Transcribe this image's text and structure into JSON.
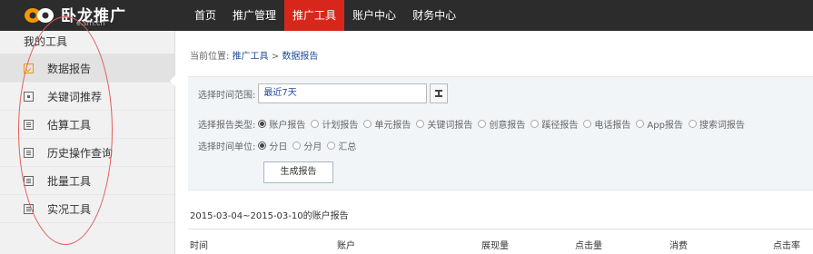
{
  "logo": {
    "text": "卧龙推广",
    "sub": "e.sm.cn"
  },
  "nav": [
    "首页",
    "推广管理",
    "推广工具",
    "账户中心",
    "财务中心"
  ],
  "nav_active_index": 2,
  "sidebar": {
    "title": "我的工具",
    "items": [
      {
        "label": "数据报告",
        "icon": "report-icon"
      },
      {
        "label": "关键词推荐",
        "icon": "target-icon"
      },
      {
        "label": "估算工具",
        "icon": "calculator-icon"
      },
      {
        "label": "历史操作查询",
        "icon": "history-icon"
      },
      {
        "label": "批量工具",
        "icon": "batch-icon"
      },
      {
        "label": "实况工具",
        "icon": "live-icon"
      }
    ]
  },
  "breadcrumb": {
    "prefix": "当前位置:",
    "link1": "推广工具",
    "sep": ">",
    "current": "数据报告"
  },
  "filters": {
    "time_range_label": "选择时间范围:",
    "time_range_value": "最近7天",
    "report_type_label": "选择报告类型:",
    "report_types": [
      "账户报告",
      "计划报告",
      "单元报告",
      "关键词报告",
      "创意报告",
      "蹊径报告",
      "电话报告",
      "App报告",
      "搜索词报告"
    ],
    "report_type_selected": 0,
    "unit_label": "选择时间单位:",
    "units": [
      "分日",
      "分月",
      "汇总"
    ],
    "unit_selected": 0,
    "generate_label": "生成报告"
  },
  "report": {
    "range_title": "2015-03-04~2015-03-10的账户报告",
    "columns": [
      "时间",
      "账户",
      "展现量",
      "点击量",
      "消费",
      "点击率"
    ]
  },
  "colors": {
    "topbar": "#2c2c2c",
    "accent": "#d9261c",
    "link": "#1f4c99",
    "annotation": "#e35d5d"
  }
}
